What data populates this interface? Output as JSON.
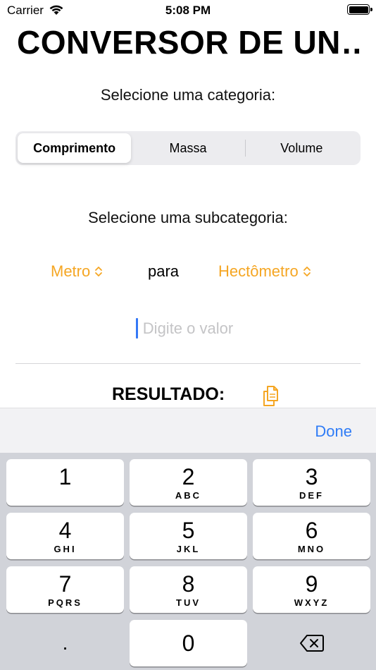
{
  "status": {
    "carrier": "Carrier",
    "time": "5:08 PM"
  },
  "title": "CONVERSOR DE UN…",
  "category": {
    "prompt": "Selecione uma categoria:",
    "options": [
      "Comprimento",
      "Massa",
      "Volume"
    ],
    "selected": "Comprimento"
  },
  "subcategory": {
    "prompt": "Selecione uma subcategoria:",
    "from": "Metro",
    "connector": "para",
    "to": "Hectômetro"
  },
  "input": {
    "placeholder": "Digite o valor",
    "value": ""
  },
  "result": {
    "label": "RESULTADO:"
  },
  "toolbar": {
    "done_label": "Done"
  },
  "keyboard": {
    "keys": [
      {
        "digit": "1",
        "letters": ""
      },
      {
        "digit": "2",
        "letters": "ABC"
      },
      {
        "digit": "3",
        "letters": "DEF"
      },
      {
        "digit": "4",
        "letters": "GHI"
      },
      {
        "digit": "5",
        "letters": "JKL"
      },
      {
        "digit": "6",
        "letters": "MNO"
      },
      {
        "digit": "7",
        "letters": "PQRS"
      },
      {
        "digit": "8",
        "letters": "TUV"
      },
      {
        "digit": "9",
        "letters": "WXYZ"
      },
      {
        "digit": "0",
        "letters": ""
      }
    ],
    "decimal": "."
  },
  "colors": {
    "accent": "#f5a623",
    "link": "#2f7cf6",
    "caret": "#3478f6"
  },
  "icons": [
    "wifi-icon",
    "battery-icon",
    "updown-chevron-icon",
    "copy-icon",
    "delete-icon"
  ]
}
